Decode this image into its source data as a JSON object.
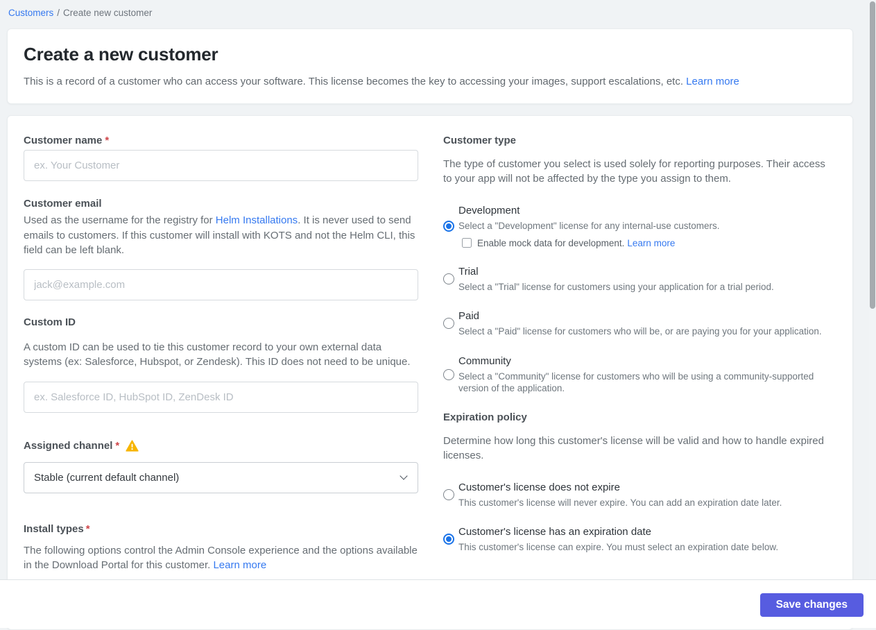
{
  "breadcrumb": {
    "link": "Customers",
    "separator": "/",
    "current": "Create new customer"
  },
  "intro": {
    "title": "Create a new customer",
    "description": "This is a record of a customer who can access your software. This license becomes the key to accessing your images, support escalations, etc. ",
    "learn_more": "Learn more"
  },
  "form": {
    "customer_name": {
      "label": "Customer name",
      "required": "*",
      "value": "",
      "placeholder": "ex. Your Customer"
    },
    "customer_email": {
      "label": "Customer email",
      "desc_before": "Used as the username for the registry for ",
      "desc_link": "Helm Installations",
      "desc_after": ". It is never used to send emails to customers. If this customer will install with KOTS and not the Helm CLI, this field can be left blank.",
      "value": "",
      "placeholder": "jack@example.com"
    },
    "custom_id": {
      "label": "Custom ID",
      "description": "A custom ID can be used to tie this customer record to your own external data systems (ex: Salesforce, Hubspot, or Zendesk). This ID does not need to be unique.",
      "value": "",
      "placeholder": "ex. Salesforce ID, HubSpot ID, ZenDesk ID"
    },
    "assigned_channel": {
      "label": "Assigned channel",
      "required": "*",
      "warning_icon": "warning-triangle-icon",
      "selected_option": "Stable (current default channel)"
    },
    "install_types": {
      "label": "Install types",
      "required": "*",
      "description": "The following options control the Admin Console experience and the options available in the Download Portal for this customer. ",
      "learn_more": "Learn more"
    }
  },
  "customer_type": {
    "heading": "Customer type",
    "description": "The type of customer you select is used solely for reporting purposes. Their access to your app will not be affected by the type you assign to them.",
    "options": [
      {
        "title": "Development",
        "description": "Select a \"Development\" license for any internal-use customers.",
        "selected": true,
        "checkbox": {
          "label": "Enable mock data for development. ",
          "learn_more": "Learn more",
          "checked": false
        }
      },
      {
        "title": "Trial",
        "description": "Select a \"Trial\" license for customers using your application for a trial period.",
        "selected": false
      },
      {
        "title": "Paid",
        "description": "Select a \"Paid\" license for customers who will be, or are paying you for your application.",
        "selected": false
      },
      {
        "title": "Community",
        "description": "Select a \"Community\" license for customers who will be using a community-supported version of the application.",
        "selected": false
      }
    ]
  },
  "expiration_policy": {
    "heading": "Expiration policy",
    "description": "Determine how long this customer's license will be valid and how to handle expired licenses.",
    "options": [
      {
        "title": "Customer's license does not expire",
        "description": "This customer's license will never expire. You can add an expiration date later.",
        "selected": false
      },
      {
        "title": "Customer's license has an expiration date",
        "description": "This customer's license can expire. You must select an expiration date below.",
        "selected": true
      }
    ]
  },
  "footer": {
    "save_label": "Save changes"
  },
  "colors": {
    "page_background": "#f0f3f5",
    "link_blue": "#3579f0",
    "button_indigo": "#575ce0",
    "radio_accent": "#1a73e8",
    "warning_amber": "#f7b500",
    "required_red": "#cf4549"
  }
}
